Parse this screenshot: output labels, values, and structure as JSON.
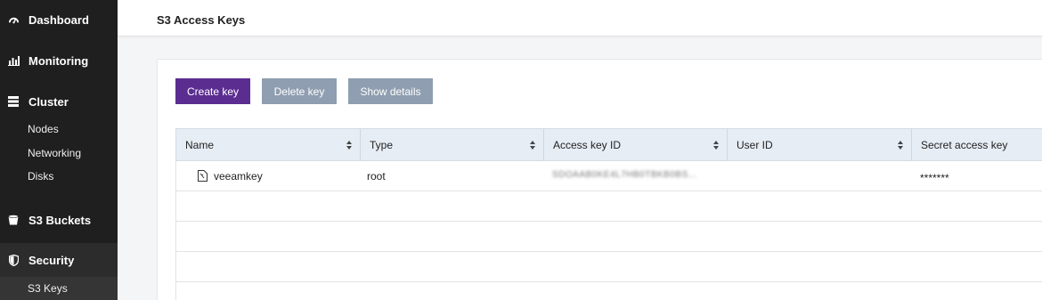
{
  "sidebar": {
    "items": [
      {
        "label": "Dashboard",
        "icon": "dashboard-icon"
      },
      {
        "label": "Monitoring",
        "icon": "chart-icon"
      },
      {
        "label": "Cluster",
        "icon": "server-icon"
      },
      {
        "label": "S3 Buckets",
        "icon": "bucket-icon"
      },
      {
        "label": "Security",
        "icon": "shield-icon"
      }
    ],
    "cluster_sub": [
      "Nodes",
      "Networking",
      "Disks"
    ],
    "security_sub": [
      "S3 Keys"
    ]
  },
  "header": {
    "title": "S3 Access Keys"
  },
  "toolbar": {
    "create_label": "Create key",
    "delete_label": "Delete key",
    "details_label": "Show details"
  },
  "table": {
    "columns": [
      "Name",
      "Type",
      "Access key ID",
      "User ID",
      "Secret access key"
    ],
    "rows": [
      {
        "name": "veeamkey",
        "type": "root",
        "access_key_id": "SDOAAB0KE4L7HB0TBKB0BS...",
        "user_id": "",
        "secret": "*******"
      }
    ]
  },
  "colors": {
    "sidebar_bg": "#1f1f1f",
    "primary": "#5b2d91",
    "disabled": "#8f9eb0",
    "table_header": "#e7edf5"
  }
}
